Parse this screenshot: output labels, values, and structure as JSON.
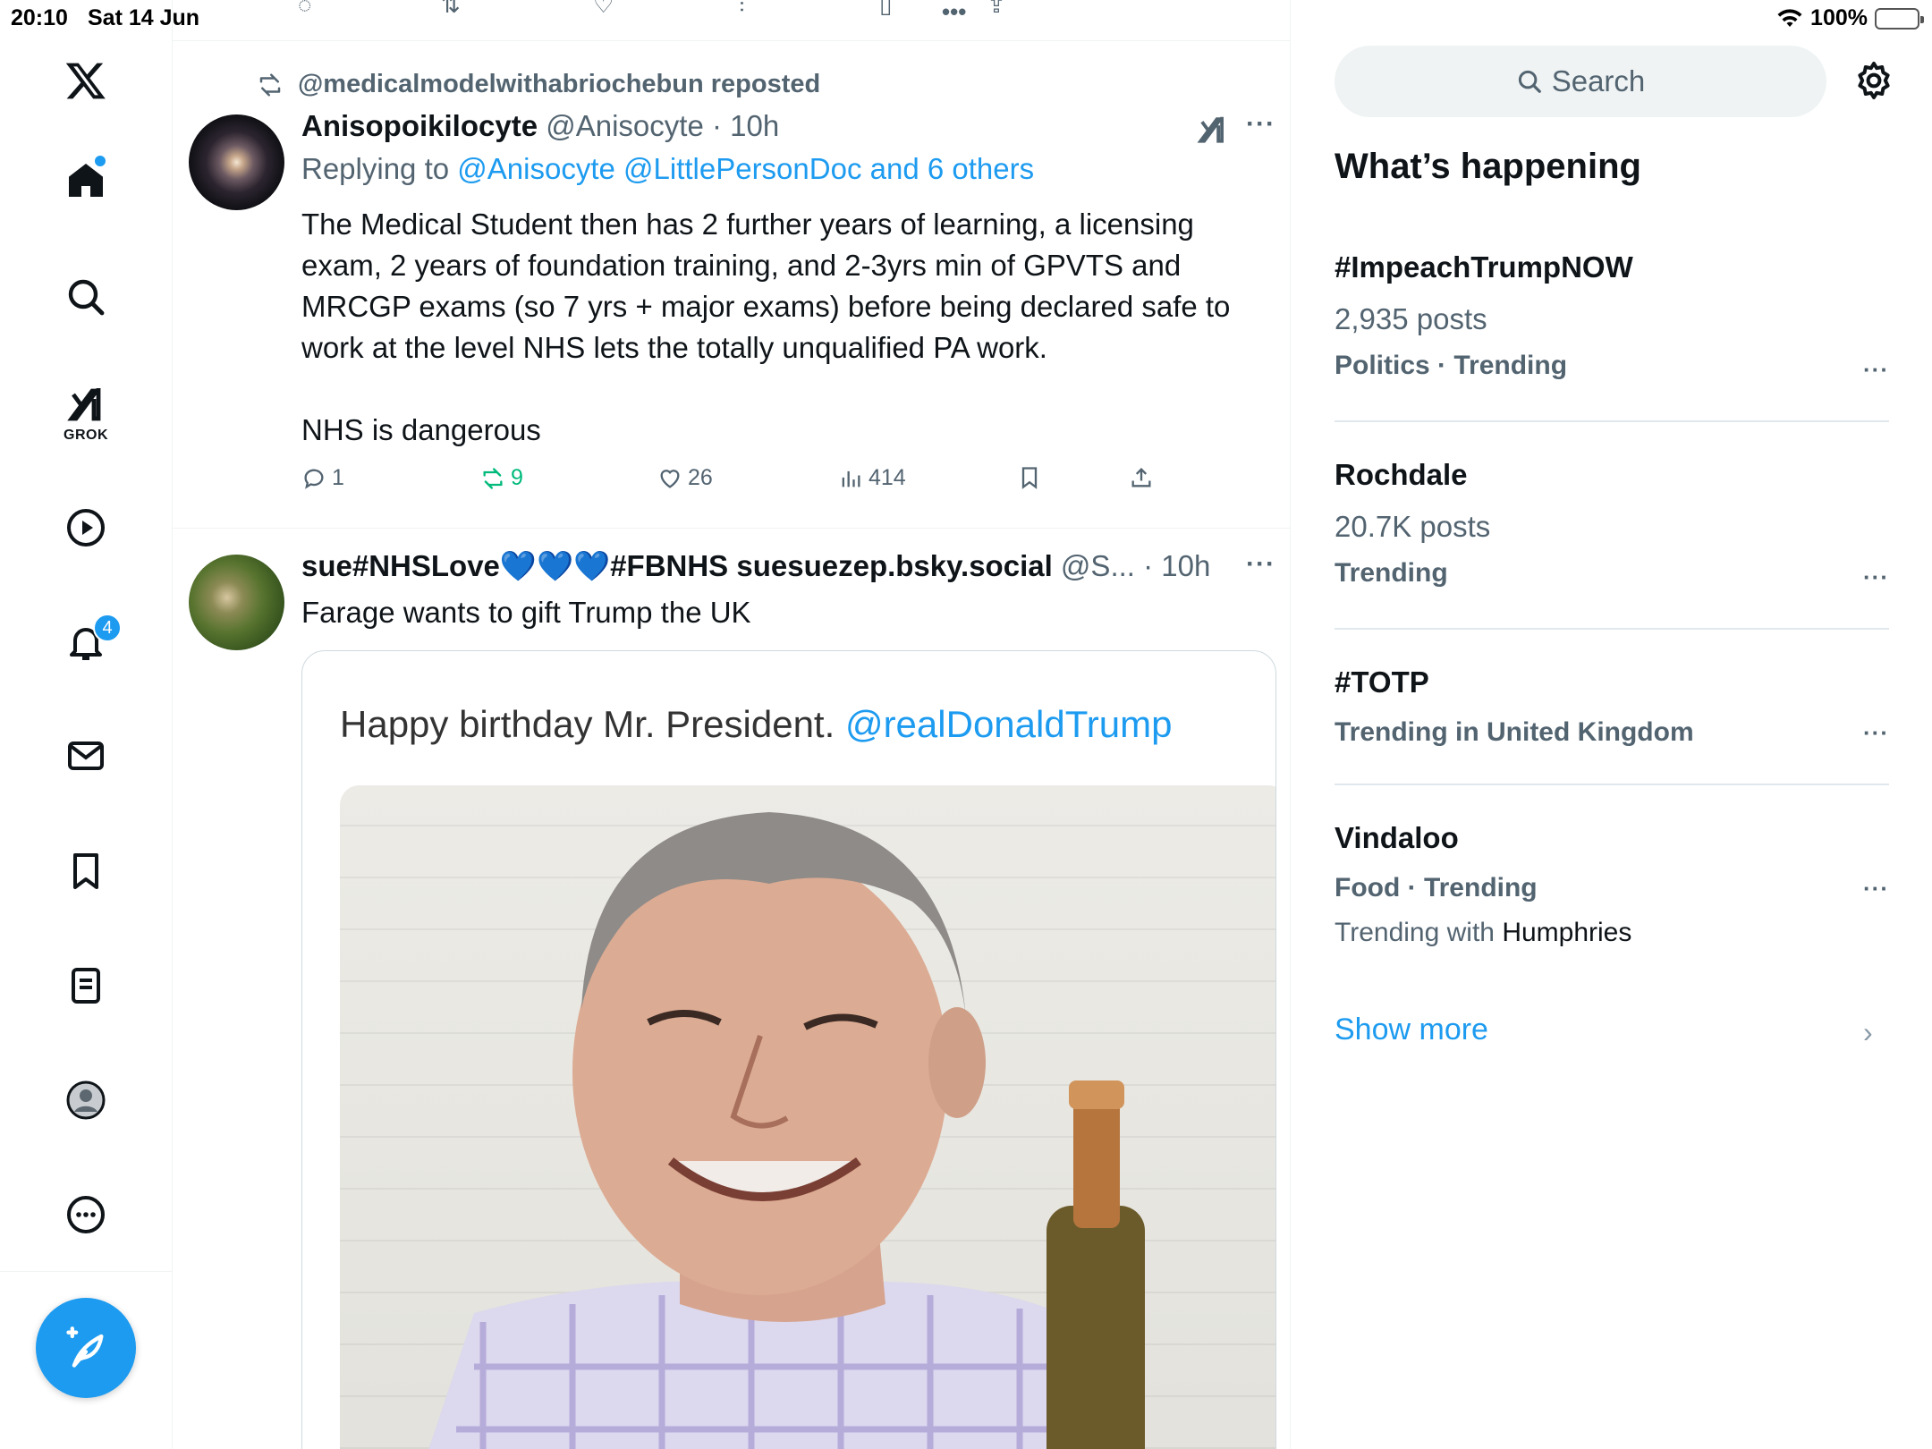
{
  "status_bar": {
    "time": "20:10",
    "date": "Sat 14 Jun",
    "battery": "100%"
  },
  "nav": {
    "grok_label": "GROK",
    "notifications_count": "4"
  },
  "tweet1": {
    "repost_by": "@medicalmodelwithabriochebun reposted",
    "name": "Anisopoikilocyte",
    "meta": " @Anisocyte · 10h",
    "replying_prefix": "Replying to ",
    "replying_to": "@Anisocyte @LittlePersonDoc and 6 others",
    "body": "The Medical Student then has 2 further years of learning, a licensing exam, 2 years of foundation training, and 2-3yrs min of GPVTS and MRCGP exams (so 7 yrs + major exams) before being declared safe to work at the level NHS lets the totally unqualified PA work.\n\nNHS is dangerous",
    "replies": "1",
    "reposts": "9",
    "likes": "26",
    "views": "414"
  },
  "tweet2": {
    "name": "sue#NHSLove💙💙💙#FBNHS suesuezep.bsky.social",
    "meta": " @S... · 10h",
    "text": "Farage wants to gift Trump the UK",
    "media_caption_text": "Happy birthday Mr. President. ",
    "media_caption_link": "@realDonaldTrump"
  },
  "sidebar": {
    "search_placeholder": "Search",
    "title": "What’s happening",
    "trends": [
      {
        "title": "#ImpeachTrumpNOW",
        "posts": "2,935 posts",
        "context": "Politics · Trending"
      },
      {
        "title": "Rochdale",
        "posts": "20.7K posts",
        "context": "Trending"
      },
      {
        "title": "#TOTP",
        "context": "Trending in United Kingdom"
      },
      {
        "title": "Vindaloo",
        "context": "Food · Trending",
        "with_prefix": "Trending with ",
        "with_name": "Humphries"
      }
    ],
    "show_more": "Show more"
  },
  "colors": {
    "accent": "#1d9bf0",
    "repost_green": "#00ba7c",
    "muted": "#536471",
    "text": "#0f1419"
  }
}
